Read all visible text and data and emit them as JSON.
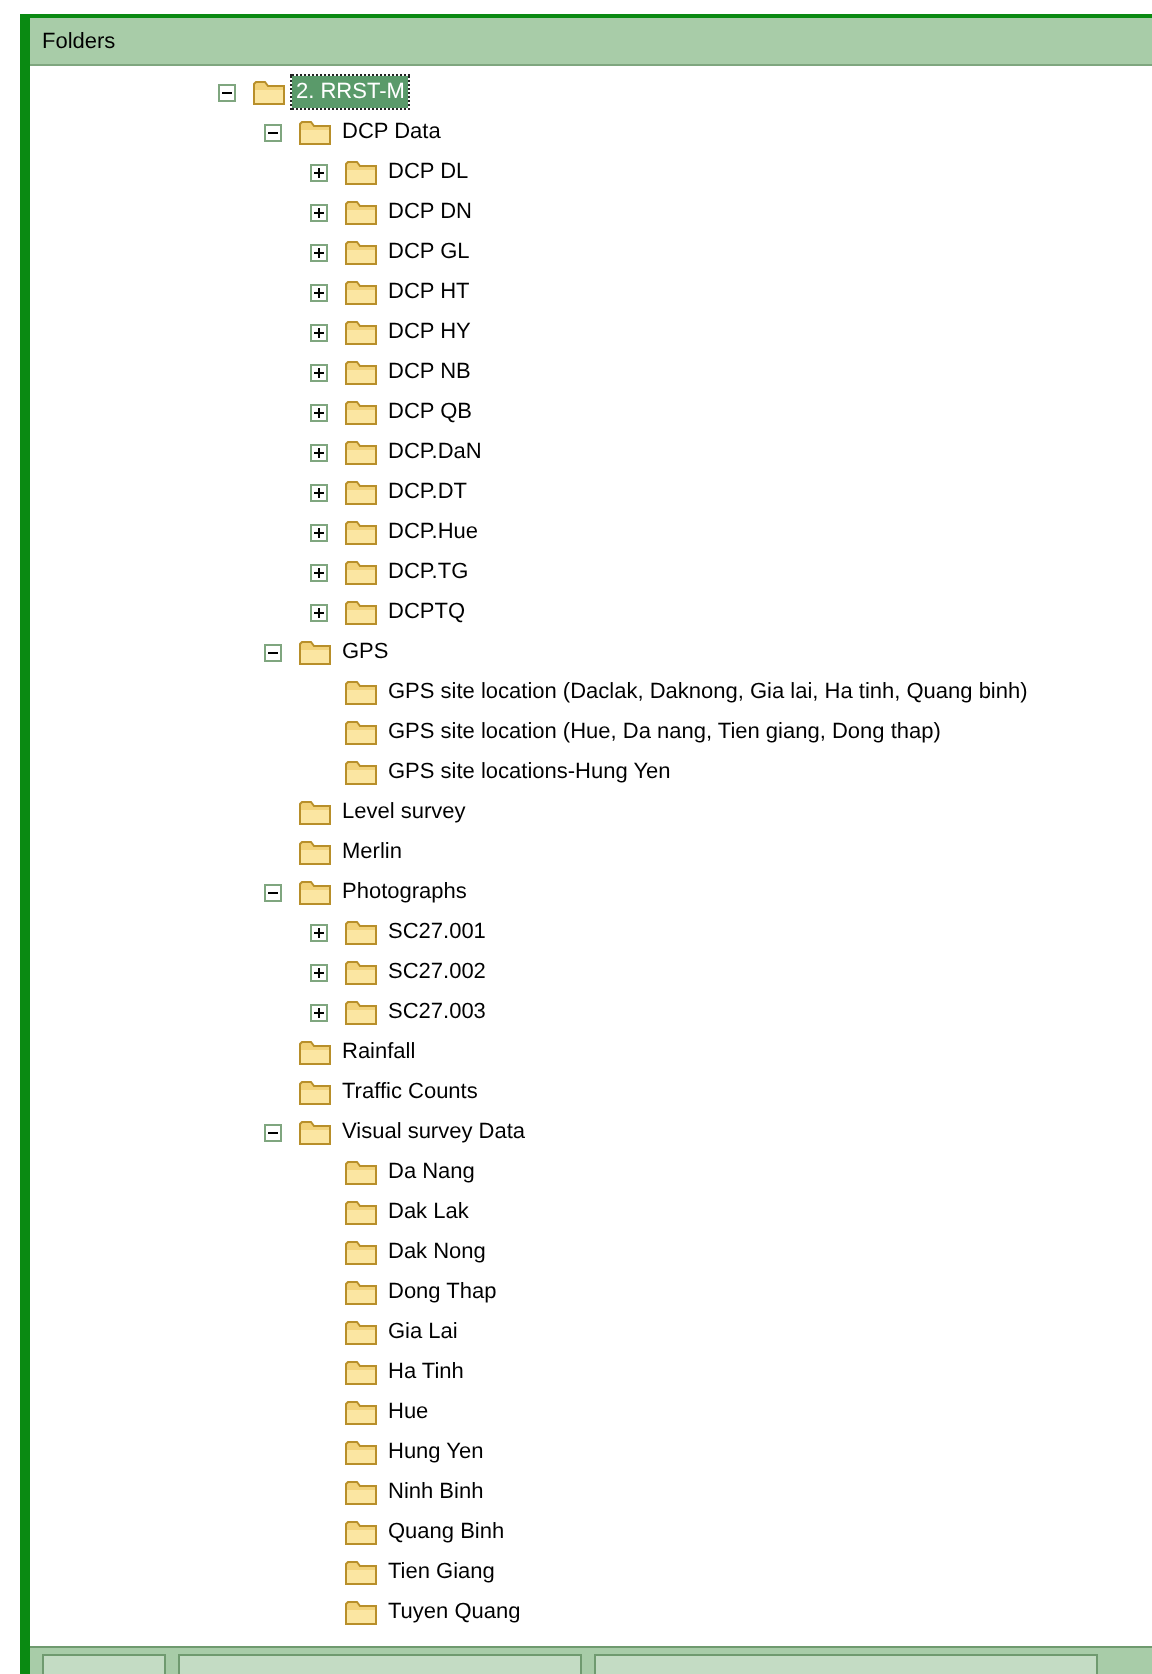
{
  "panel": {
    "title": "Folders"
  },
  "tree": [
    {
      "label": "2. RRST-M",
      "selected": true,
      "expanded": true,
      "children": [
        {
          "label": "DCP Data",
          "selected": false,
          "expanded": true,
          "children": [
            {
              "label": "DCP DL",
              "selected": false,
              "expanded": false
            },
            {
              "label": "DCP DN",
              "selected": false,
              "expanded": false
            },
            {
              "label": "DCP GL",
              "selected": false,
              "expanded": false
            },
            {
              "label": "DCP HT",
              "selected": false,
              "expanded": false
            },
            {
              "label": "DCP HY",
              "selected": false,
              "expanded": false
            },
            {
              "label": "DCP NB",
              "selected": false,
              "expanded": false
            },
            {
              "label": "DCP QB",
              "selected": false,
              "expanded": false
            },
            {
              "label": "DCP.DaN",
              "selected": false,
              "expanded": false
            },
            {
              "label": "DCP.DT",
              "selected": false,
              "expanded": false
            },
            {
              "label": "DCP.Hue",
              "selected": false,
              "expanded": false
            },
            {
              "label": "DCP.TG",
              "selected": false,
              "expanded": false
            },
            {
              "label": "DCPTQ",
              "selected": false,
              "expanded": false
            }
          ]
        },
        {
          "label": "GPS",
          "selected": false,
          "expanded": true,
          "children": [
            {
              "label": "GPS site location (Daclak, Daknong, Gia lai, Ha tinh, Quang binh)",
              "selected": false
            },
            {
              "label": "GPS site location (Hue, Da nang, Tien giang, Dong thap)",
              "selected": false
            },
            {
              "label": "GPS site locations-Hung Yen",
              "selected": false
            }
          ]
        },
        {
          "label": "Level survey",
          "selected": false
        },
        {
          "label": "Merlin",
          "selected": false
        },
        {
          "label": "Photographs",
          "selected": false,
          "expanded": true,
          "children": [
            {
              "label": "SC27.001",
              "selected": false,
              "expanded": false
            },
            {
              "label": "SC27.002",
              "selected": false,
              "expanded": false
            },
            {
              "label": "SC27.003",
              "selected": false,
              "expanded": false
            }
          ]
        },
        {
          "label": "Rainfall",
          "selected": false
        },
        {
          "label": "Traffic Counts",
          "selected": false
        },
        {
          "label": "Visual survey Data",
          "selected": false,
          "expanded": true,
          "children": [
            {
              "label": "Da Nang",
              "selected": false
            },
            {
              "label": "Dak Lak",
              "selected": false
            },
            {
              "label": "Dak Nong",
              "selected": false
            },
            {
              "label": "Dong Thap",
              "selected": false
            },
            {
              "label": "Gia Lai",
              "selected": false
            },
            {
              "label": "Ha Tinh",
              "selected": false
            },
            {
              "label": "Hue",
              "selected": false
            },
            {
              "label": "Hung Yen",
              "selected": false
            },
            {
              "label": "Ninh Binh",
              "selected": false
            },
            {
              "label": "Quang Binh",
              "selected": false
            },
            {
              "label": "Tien Giang",
              "selected": false
            },
            {
              "label": "Tuyen Quang",
              "selected": false
            }
          ]
        }
      ]
    }
  ]
}
